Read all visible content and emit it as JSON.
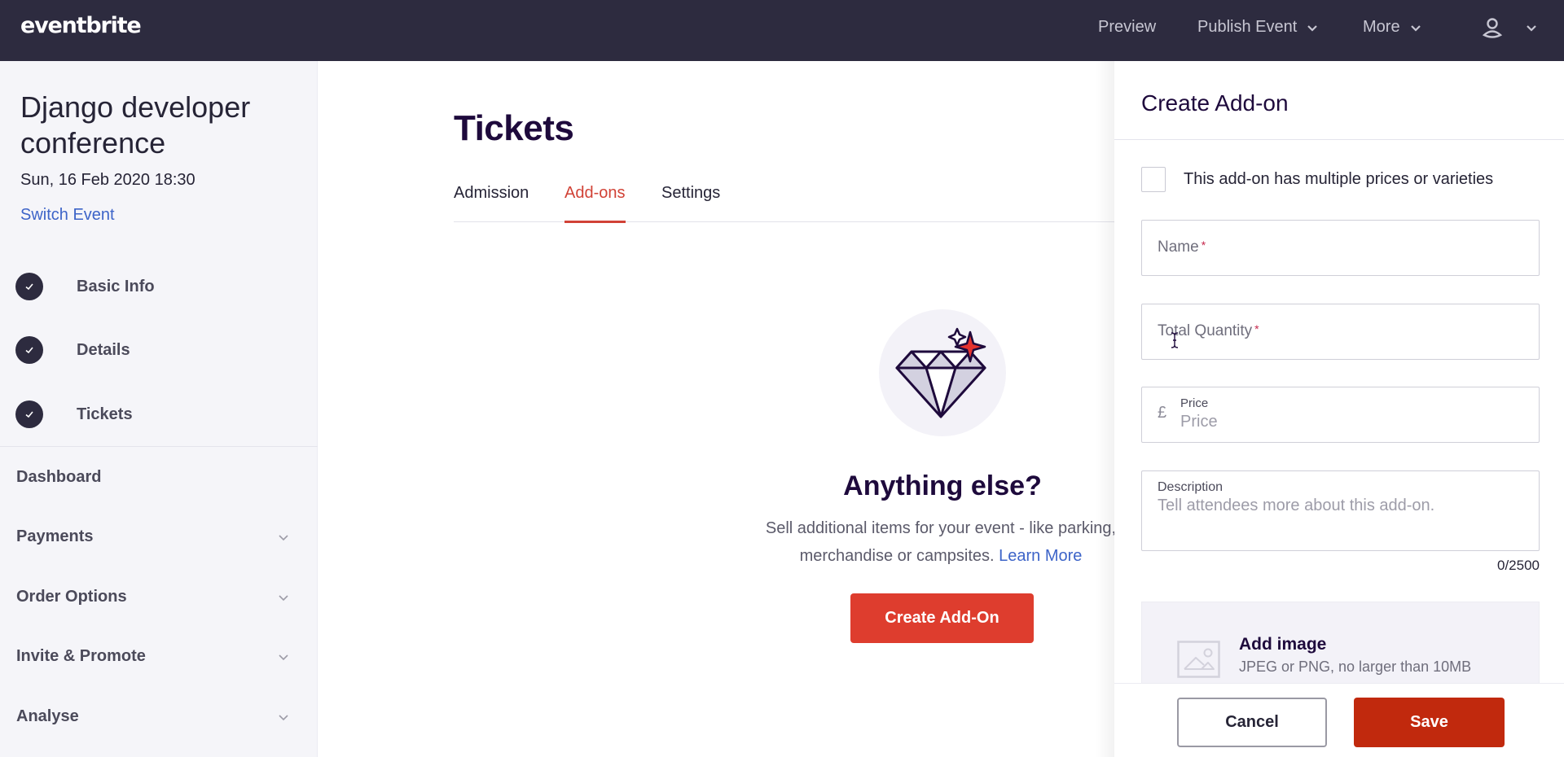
{
  "topbar": {
    "logo": "eventbrite",
    "preview": "Preview",
    "publish_event": "Publish Event",
    "more": "More",
    "user_icon": "user-icon"
  },
  "sidebar": {
    "event_title": "Django developer conference",
    "event_date": "Sun, 16 Feb 2020 18:30",
    "switch_event": "Switch Event",
    "steps": [
      {
        "label": "Basic Info",
        "completed": true
      },
      {
        "label": "Details",
        "completed": true
      },
      {
        "label": "Tickets",
        "completed": true
      }
    ],
    "menu": [
      {
        "label": "Dashboard",
        "expandable": false
      },
      {
        "label": "Payments",
        "expandable": true
      },
      {
        "label": "Order Options",
        "expandable": true
      },
      {
        "label": "Invite & Promote",
        "expandable": true
      },
      {
        "label": "Analyse",
        "expandable": true
      }
    ]
  },
  "main": {
    "title": "Tickets",
    "tabs": [
      {
        "label": "Admission",
        "active": false
      },
      {
        "label": "Add-ons",
        "active": true
      },
      {
        "label": "Settings",
        "active": false
      }
    ],
    "empty_state": {
      "icon": "diamond-icon",
      "title": "Anything else?",
      "description": "Sell additional items for your event - like parking, merchandise or campsites.",
      "learn_more": "Learn More",
      "button": "Create Add-On"
    }
  },
  "panel": {
    "title": "Create Add-on",
    "multiple_prices_label": "This add-on has multiple prices or varieties",
    "multiple_prices_checked": false,
    "name": {
      "placeholder": "Name",
      "required": "*",
      "value": ""
    },
    "quantity": {
      "placeholder": "Total Quantity",
      "required": "*",
      "value": ""
    },
    "price": {
      "currency": "£",
      "label": "Price",
      "placeholder": "Price",
      "value": ""
    },
    "description": {
      "label": "Description",
      "placeholder": "Tell attendees more about this add-on.",
      "value": "",
      "counter": "0/2500"
    },
    "image": {
      "title": "Add image",
      "subtitle": "JPEG or PNG, no larger than 10MB"
    },
    "cancel": "Cancel",
    "save": "Save"
  },
  "colors": {
    "topbar_bg": "#2d2b3f",
    "accent_red": "#d14236",
    "save_red": "#c1290d",
    "link_blue": "#3d64c8"
  }
}
